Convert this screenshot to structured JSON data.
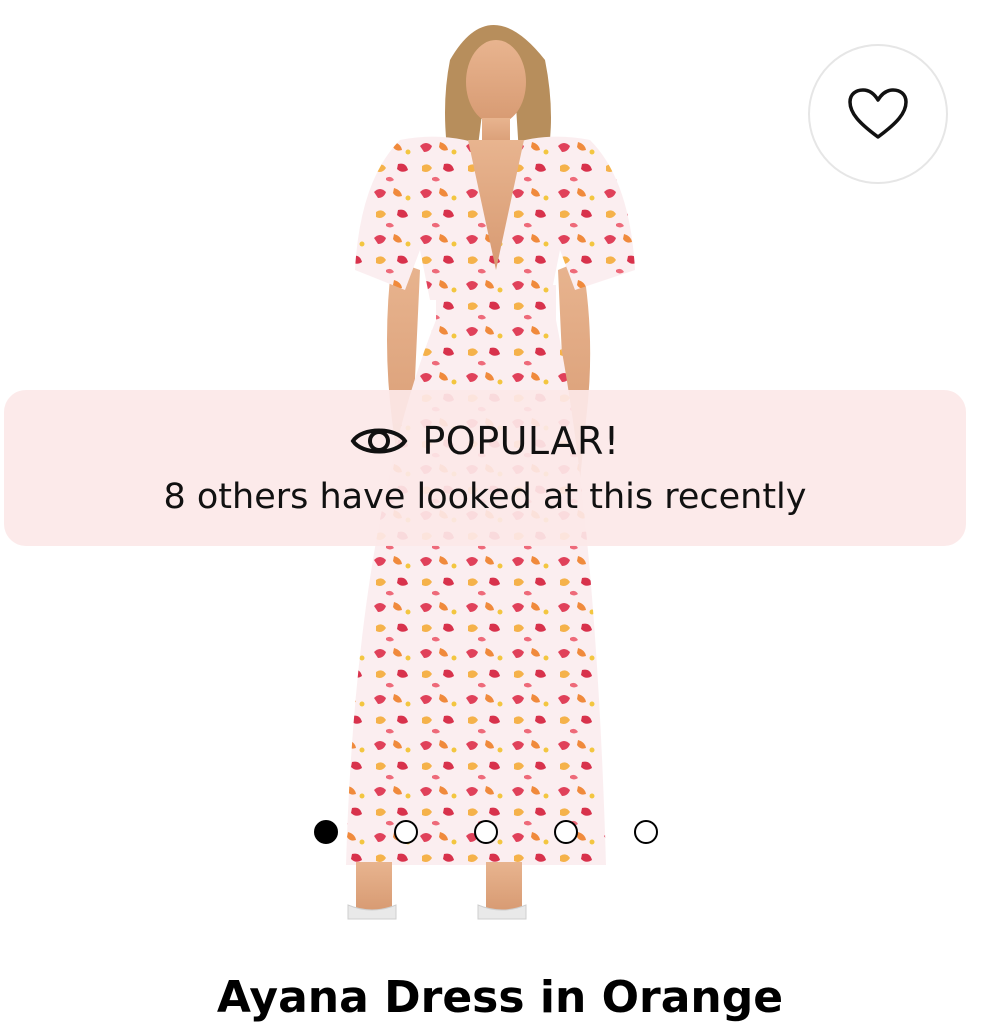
{
  "product": {
    "title": "Ayana Dress in Orange",
    "image_alt_icon": "dress-photo"
  },
  "wishlist": {
    "icon": "heart-icon"
  },
  "popular_banner": {
    "icon": "eye-icon",
    "title": "POPULAR!",
    "message": "8 others have looked at this recently"
  },
  "carousel": {
    "total": 5,
    "active_index": 0
  },
  "colors": {
    "banner_bg": "#fce8e8",
    "dot_active": "#000000"
  }
}
